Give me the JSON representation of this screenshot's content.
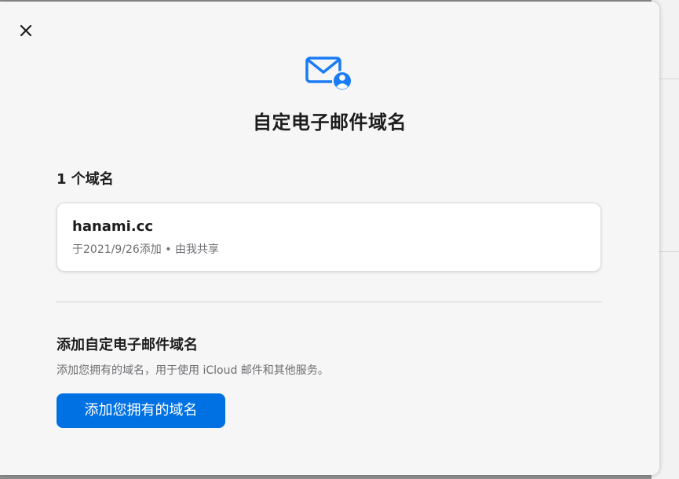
{
  "dialog": {
    "close_icon": "close-icon",
    "header_icon": "mail-person-icon",
    "title": "自定电子邮件域名"
  },
  "domains": {
    "count_label": "1 个域名",
    "items": [
      {
        "name": "hanami.cc",
        "meta": "于2021/9/26添加 • 由我共享"
      }
    ]
  },
  "add_section": {
    "heading": "添加自定电子邮件域名",
    "description": "添加您拥有的域名，用于使用 iCloud 邮件和其他服务。",
    "button_label": "添加您拥有的域名"
  },
  "colors": {
    "accent": "#0071e3",
    "icon_blue": "#1a7cf5",
    "title_text": "#1d1d1f",
    "secondary_text": "#6e6e73",
    "dialog_background": "#f6f6f6"
  }
}
